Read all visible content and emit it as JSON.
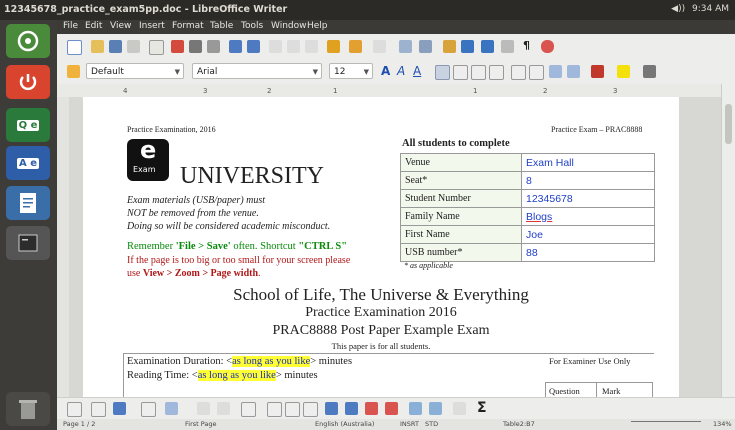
{
  "window": {
    "title": "12345678_practice_exam5pp.doc - LibreOffice Writer",
    "volume_label": "◀))",
    "time": "9:34 AM"
  },
  "menu": [
    "File",
    "Edit",
    "View",
    "Insert",
    "Format",
    "Table",
    "Tools",
    "Window",
    "Help"
  ],
  "formatting": {
    "style": "Default",
    "font": "Arial",
    "size": "12"
  },
  "ruler_ticks": [
    "4",
    "3",
    "2",
    "1",
    "1",
    "2",
    "3"
  ],
  "document": {
    "header_left": "Practice Examination, 2016",
    "header_right": "Practice Exam – PRAC8888",
    "logo_letter": "e",
    "logo_word": "Exam",
    "university": "UNIVERSITY",
    "notice_1": "Exam materials (USB/paper) must",
    "notice_2": "NOT be removed from the venue.",
    "notice_3": "Doing so will be considered academic misconduct.",
    "remember_prefix": "Remember ",
    "remember_file": "'File > Save'",
    "remember_mid": " often. Shortcut ",
    "remember_ctrl": "\"CTRL S\"",
    "small_1": "If the page is too big or too small for your screen please",
    "small_2_prefix": "use ",
    "small_2_bold": "View > Zoom > Page width",
    "small_2_suffix": ".",
    "table_title": "All students to complete",
    "table_rows": [
      {
        "label": "Venue",
        "value": "Exam Hall"
      },
      {
        "label": "Seat*",
        "value": "8"
      },
      {
        "label": "Student Number",
        "value": "12345678"
      },
      {
        "label": "Family Name",
        "value": "Blogs"
      },
      {
        "label": "First Name",
        "value": "Joe"
      },
      {
        "label": "USB number*",
        "value": "88"
      }
    ],
    "as_applicable": "* as applicable",
    "school": "School of Life, The Universe & Everything",
    "practice": "Practice Examination 2016",
    "course": "PRAC8888 Post Paper Example Exam",
    "for_all": "This paper is for all students.",
    "duration_prefix": "Examination Duration: <",
    "duration_hl": "as long as you like",
    "duration_suffix": "> minutes",
    "reading_prefix": "Reading Time: <",
    "reading_hl": "as long as you like",
    "reading_suffix": "> minutes",
    "examiner_title": "For Examiner Use Only",
    "col_question": "Question",
    "col_mark": "Mark"
  },
  "status": {
    "page": "Page 1 / 2",
    "page_style": "First Page",
    "language": "English (Australia)",
    "insert": "INSRT",
    "std": "STD",
    "cell": "Table2:B7",
    "zoom": "134%"
  },
  "bottom_symbols": {
    "sigma": "Σ"
  },
  "colors": {
    "accent_blue": "#1f3fc8",
    "green_text": "#0a8a0a",
    "red_text": "#b01818",
    "highlight": "#ffff33"
  }
}
